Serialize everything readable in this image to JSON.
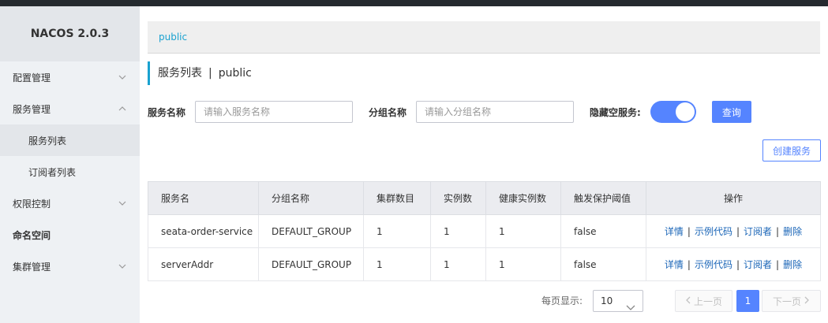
{
  "app": {
    "title": "NACOS 2.0.3"
  },
  "sidebar": {
    "items": [
      {
        "label": "配置管理",
        "chevron": "down"
      },
      {
        "label": "服务管理",
        "chevron": "up"
      },
      {
        "label": "服务列表",
        "sub": true,
        "active": true
      },
      {
        "label": "订阅者列表",
        "sub": true
      },
      {
        "label": "权限控制",
        "chevron": "down"
      },
      {
        "label": "命名空间"
      },
      {
        "label": "集群管理",
        "chevron": "down"
      }
    ]
  },
  "namespace": {
    "current": "public"
  },
  "page": {
    "title": "服务列表",
    "separator": "|",
    "namespace": "public"
  },
  "filters": {
    "service_name_label": "服务名称",
    "service_name_placeholder": "请输入服务名称",
    "group_name_label": "分组名称",
    "group_name_placeholder": "请输入分组名称",
    "hide_empty_label": "隐藏空服务:",
    "hide_empty_on": true,
    "query_button": "查询"
  },
  "create_button": "创建服务",
  "table": {
    "columns": [
      "服务名",
      "分组名称",
      "集群数目",
      "实例数",
      "健康实例数",
      "触发保护阈值",
      "操作"
    ],
    "rows": [
      {
        "name": "seata-order-service",
        "group": "DEFAULT_GROUP",
        "clusters": "1",
        "instances": "1",
        "healthy": "1",
        "threshold": "false"
      },
      {
        "name": "serverAddr",
        "group": "DEFAULT_GROUP",
        "clusters": "1",
        "instances": "1",
        "healthy": "1",
        "threshold": "false"
      }
    ],
    "actions": {
      "detail": "详情",
      "sample": "示例代码",
      "subscribers": "订阅者",
      "delete": "删除",
      "sep": "|"
    }
  },
  "pagination": {
    "page_size_label": "每页显示:",
    "page_size": "10",
    "prev": "上一页",
    "next": "下一页",
    "current_page": "1"
  },
  "colors": {
    "accent": "#5584ff",
    "link": "#1a65b7",
    "namespace": "#1aa2d0",
    "sidebar_bg": "#eef1f4"
  }
}
